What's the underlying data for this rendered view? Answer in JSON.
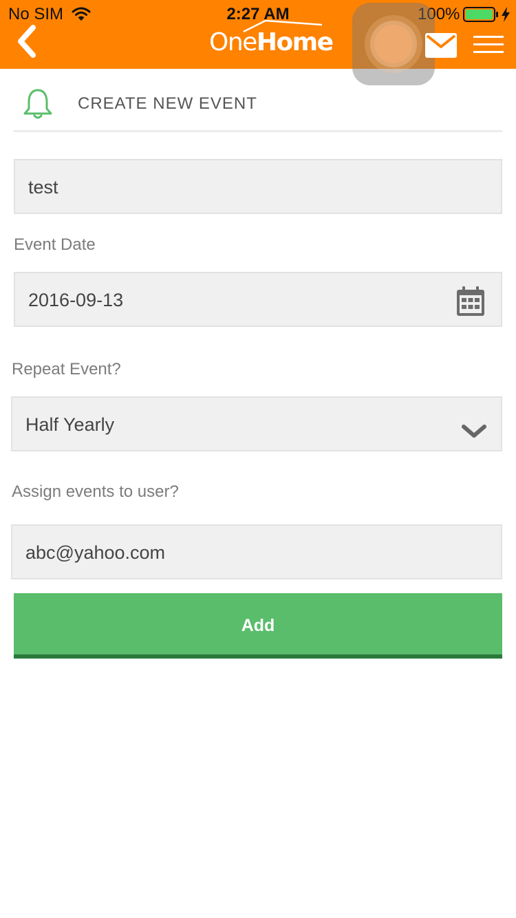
{
  "status_bar": {
    "carrier": "No SIM",
    "time": "2:27 AM",
    "battery": "100%"
  },
  "header": {
    "logo_light": "One",
    "logo_bold": "Home",
    "icons": [
      "back-chevron-icon",
      "mail-icon",
      "hamburger-menu-icon"
    ]
  },
  "section": {
    "title": "CREATE NEW EVENT",
    "icon": "bell-icon"
  },
  "form": {
    "event_name": {
      "value": "test"
    },
    "event_date": {
      "label": "Event Date",
      "value": "2016-09-13",
      "icon": "calendar-icon"
    },
    "repeat": {
      "label": "Repeat Event?",
      "value": "Half Yearly",
      "icon": "chevron-down-icon"
    },
    "assign_user": {
      "label": "Assign events to user?",
      "value": "abc@yahoo.com"
    },
    "submit_label": "Add"
  },
  "colors": {
    "header_bg": "#ff8200",
    "accent_green": "#5abd6b",
    "button_shadow": "#2a7a3a",
    "field_bg": "#f0f0f0"
  }
}
